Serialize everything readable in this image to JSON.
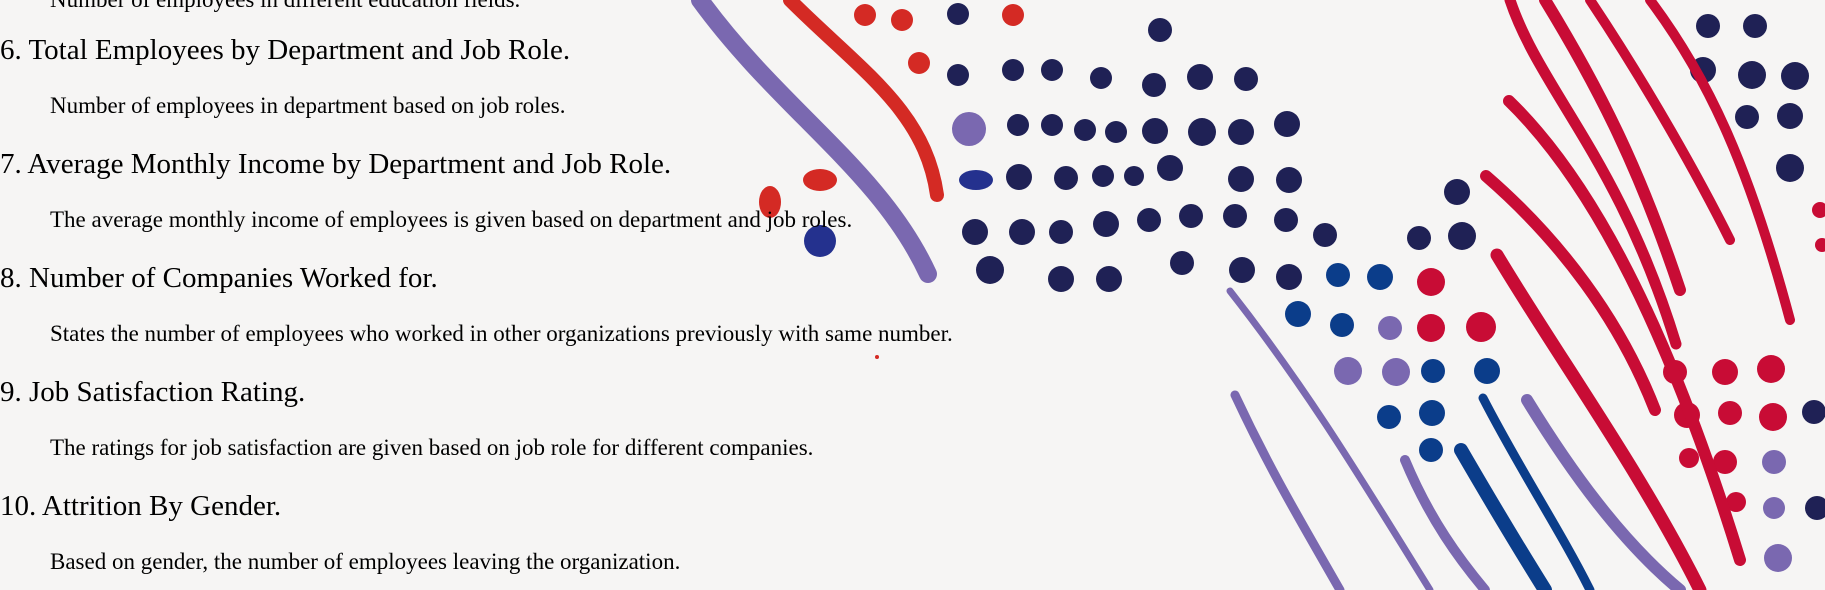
{
  "document": {
    "partial_top_line": "Number of employees in different education fields.",
    "sections": [
      {
        "number": "6.",
        "title": "Total Employees by Department and Job Role.",
        "description": "Number of employees in department based on job roles."
      },
      {
        "number": "7.",
        "title": "Average Monthly Income by Department and Job Role.",
        "description": "The average monthly income of employees is given based on department and job roles."
      },
      {
        "number": "8.",
        "title": "Number of Companies Worked for.",
        "description": "States the number of employees who worked in other organizations previously with same number."
      },
      {
        "number": "9.",
        "title": "Job Satisfaction Rating.",
        "description": "The ratings for job satisfaction are given based on job role for different companies."
      },
      {
        "number": "10.",
        "title": "Attrition By Gender.",
        "description": "Based on gender, the number of employees leaving the organization."
      }
    ]
  },
  "colors": {
    "background": "#f6f5f4",
    "navy": "#1f2155",
    "purple": "#7a68b0",
    "red": "#d42a24",
    "crimson": "#c80c35",
    "blue": "#0b3d8a"
  }
}
